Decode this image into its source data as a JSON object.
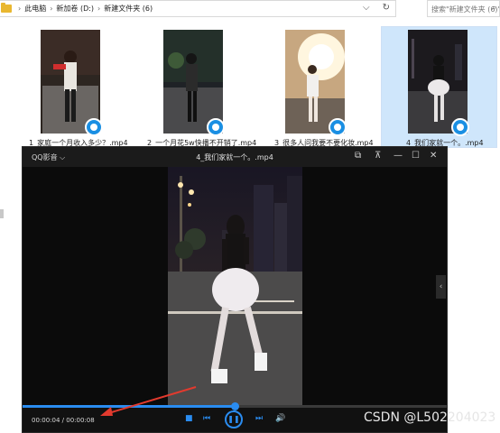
{
  "explorer": {
    "breadcrumb": [
      "此电脑",
      "新加卷 (D:)",
      "新建文件夹 (6)"
    ],
    "breadcrumb_separator": "›",
    "dropdown_glyph": "⌵",
    "refresh_glyph": "↻",
    "search_placeholder": "搜索\"新建文件夹 (6)\"",
    "search_icon_glyph": "⌕"
  },
  "files": [
    {
      "name": "1_家庭一个月收入多少？.mp4",
      "selected": false
    },
    {
      "name": "2_一个月花5w快播不开销了.mp4",
      "selected": false
    },
    {
      "name": "3_很多人问我要不要化妆.mp4",
      "selected": false
    },
    {
      "name": "4_我们家就一个。.mp4",
      "selected": true
    }
  ],
  "player": {
    "brand": "QQ影音",
    "brand_chevron": "⌵",
    "title": "4_我们家就一个。.mp4",
    "window_controls": [
      "⧉",
      "⊼",
      "—",
      "☐",
      "✕"
    ],
    "side_handle_glyph": "‹",
    "time_display": "00:00:04 / 00:00:08",
    "progress_fraction": 0.5,
    "buttons": {
      "stop": "■",
      "prev": "⏮",
      "pause": "❚❚",
      "next": "⏭",
      "volume": "🔊"
    },
    "accent_color": "#2a8cf0"
  },
  "watermark": "CSDN @L502204023"
}
